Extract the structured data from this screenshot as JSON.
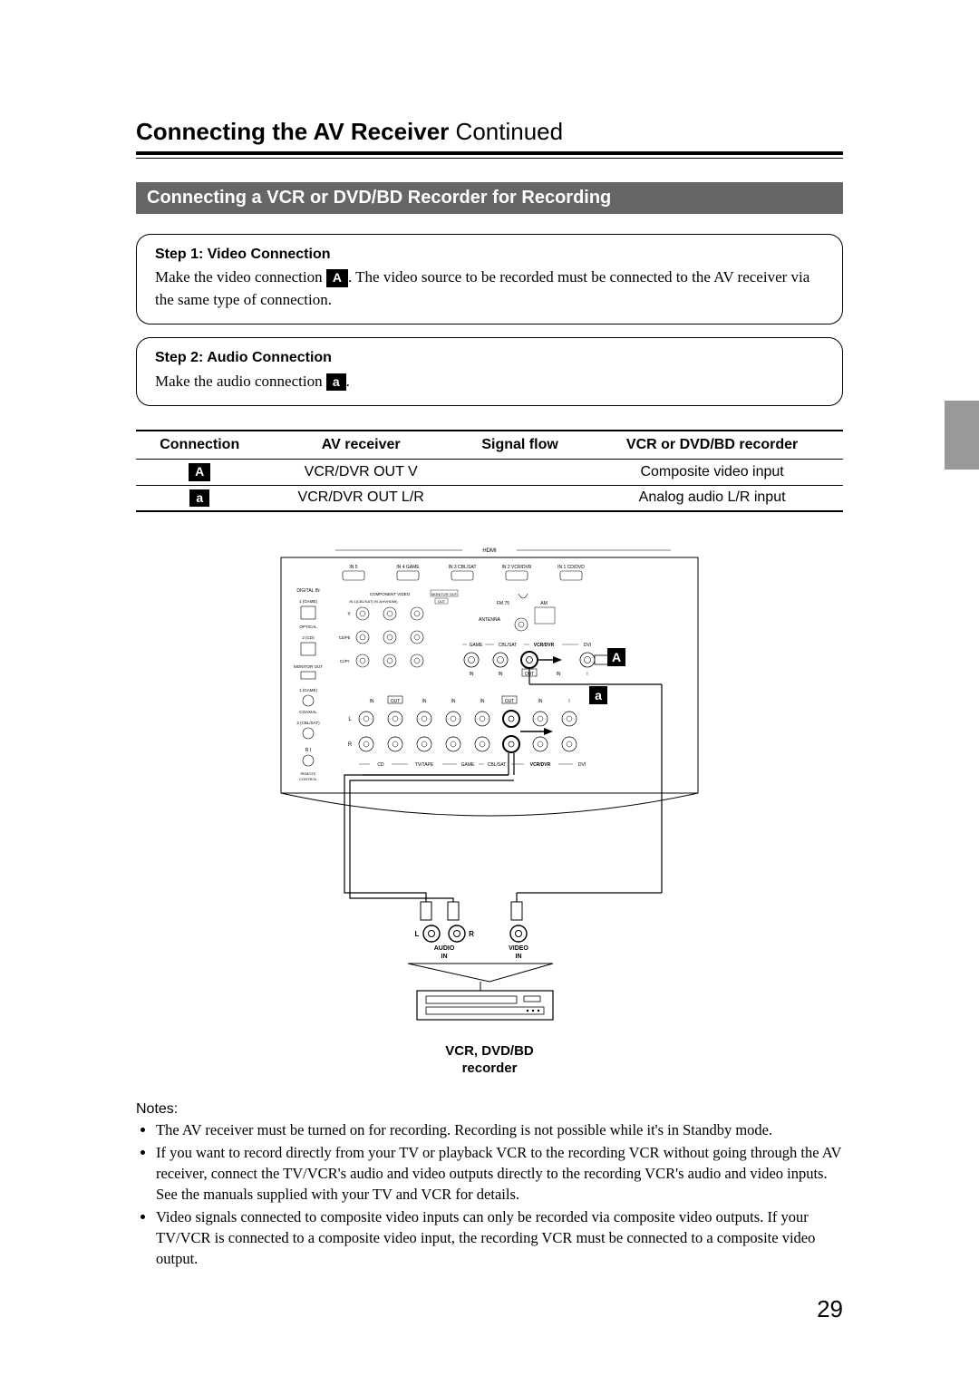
{
  "title": {
    "main": "Connecting the AV Receiver",
    "continued": " Continued"
  },
  "section_bar": "Connecting a VCR or DVD/BD Recorder for Recording",
  "step1": {
    "title": "Step 1: Video Connection",
    "before": "Make the video connection ",
    "badge": "A",
    "after": ". The video source to be recorded must be connected to the AV receiver via the same type of connection."
  },
  "step2": {
    "title": "Step 2: Audio Connection",
    "before": "Make the audio connection ",
    "badge": "a",
    "after": "."
  },
  "table": {
    "headers": [
      "Connection",
      "AV receiver",
      "Signal flow",
      "VCR or DVD/BD recorder"
    ],
    "rows": [
      {
        "badge": "A",
        "receiver": "VCR/DVR OUT V",
        "flow": "",
        "device": "Composite video input"
      },
      {
        "badge": "a",
        "receiver": "VCR/DVR OUT L/R",
        "flow": "",
        "device": "Analog audio L/R input"
      }
    ]
  },
  "diagram": {
    "badge_A": "A",
    "badge_a": "a",
    "audio_L": "L",
    "audio_R": "R",
    "audio_in": "AUDIO\nIN",
    "video_in": "VIDEO\nIN",
    "device_label": "VCR, DVD/BD\nrecorder",
    "labels": {
      "hdmi": "HDMI",
      "in5": "IN 5",
      "in4": "IN 4",
      "game": "GAME",
      "in3": "IN 3",
      "cblsat": "CBL/SAT",
      "in2": "IN 2",
      "vcrdvr": "VCR/DVR",
      "in1": "IN 1",
      "cddvd": "CD/DVD",
      "digital_in": "DIGITAL IN",
      "game_1": "1 (GAME)",
      "optical": "OPTICAL",
      "cd_2": "2 (CD)",
      "monitor_out": "MONITOR OUT",
      "game_1c": "1 (GAME)",
      "coaxial": "COAXIAL",
      "cblsat_2": "2 (CBL/SAT)",
      "ri": "R I",
      "remote_control": "REMOTE CONTROL",
      "component_video": "COMPONENT VIDEO",
      "monitor_out2": "MONITOR OUT",
      "in1_cblsat": "IN 1 (CBL/SAT)",
      "in2_tvhdmi": "IN 2(HVHDMI)",
      "out": "OUT",
      "y": "Y",
      "cbpb": "Cb/Pb",
      "crpr": "Cr/Pr",
      "fm75": "FM 75",
      "am": "AM",
      "antenna": "ANTENNA",
      "dvi": "DVI",
      "in": "IN",
      "L": "L",
      "R_": "R",
      "cd_b": "CD",
      "tvtape": "TV/TAPE",
      "game_b": "GAME",
      "cblsat_b": "CBL/SAT",
      "vcrdvr_b": "VCR/DVR",
      "dvi_b": "DVI"
    }
  },
  "notes": {
    "title": "Notes:",
    "items": [
      "The AV receiver must be turned on for recording. Recording is not possible while it's in Standby mode.",
      "If you want to record directly from your TV or playback VCR to the recording VCR without going through the AV receiver, connect the TV/VCR's audio and video outputs directly to the recording VCR's audio and video inputs. See the manuals supplied with your TV and VCR for details.",
      "Video signals connected to composite video inputs can only be recorded via composite video outputs. If your TV/VCR is connected to a composite video input, the recording VCR must be connected to a composite video output."
    ]
  },
  "page_number": "29"
}
